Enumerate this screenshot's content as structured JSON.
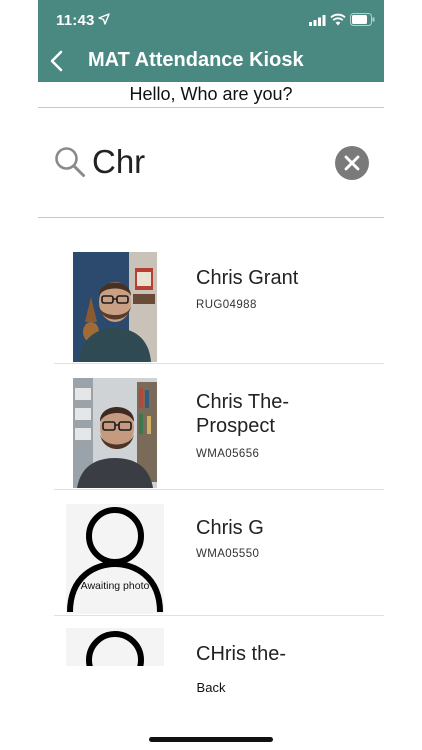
{
  "status_bar": {
    "time": "11:43"
  },
  "nav": {
    "title": "MAT Attendance Kiosk"
  },
  "greeting": "Hello, Who are you?",
  "search": {
    "value": "Chr",
    "placeholder": ""
  },
  "results": [
    {
      "name": "Chris Grant",
      "code": "RUG04988",
      "photo": "person-photo"
    },
    {
      "name": "Chris The-Prospect",
      "code": "WMA05656",
      "photo": "person-photo"
    },
    {
      "name": "Chris G",
      "code": "WMA05550",
      "photo": "placeholder-silhouette",
      "placeholder_text": "Awaiting photo"
    },
    {
      "name": "CHris the-",
      "code": "",
      "photo": "placeholder-silhouette"
    }
  ],
  "footer": {
    "back_label": "Back"
  },
  "colors": {
    "nav_bg": "#4a8882",
    "clear_button": "#7a7a7a",
    "divider": "#c9c9c9"
  }
}
